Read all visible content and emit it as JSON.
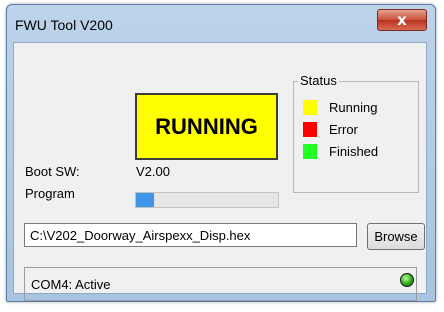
{
  "window": {
    "title": "FWU Tool V200",
    "close_label": "x"
  },
  "main": {
    "status_indicator": {
      "text": "RUNNING",
      "color": "#ffff00"
    },
    "boot_sw": {
      "label": "Boot SW:",
      "value": "V2.00"
    },
    "program": {
      "label": "Program",
      "progress_fraction": 0.13
    }
  },
  "status_legend": {
    "title": "Status",
    "items": [
      {
        "label": "Running",
        "color": "#ffff00"
      },
      {
        "label": "Error",
        "color": "#ff0000"
      },
      {
        "label": "Finished",
        "color": "#22ff22"
      }
    ]
  },
  "file": {
    "path": "C:\\V202_Doorway_Airspexx_Disp.hex",
    "browse_label": "Browse"
  },
  "statusbar": {
    "text": "COM4: Active",
    "led_color": "green"
  }
}
